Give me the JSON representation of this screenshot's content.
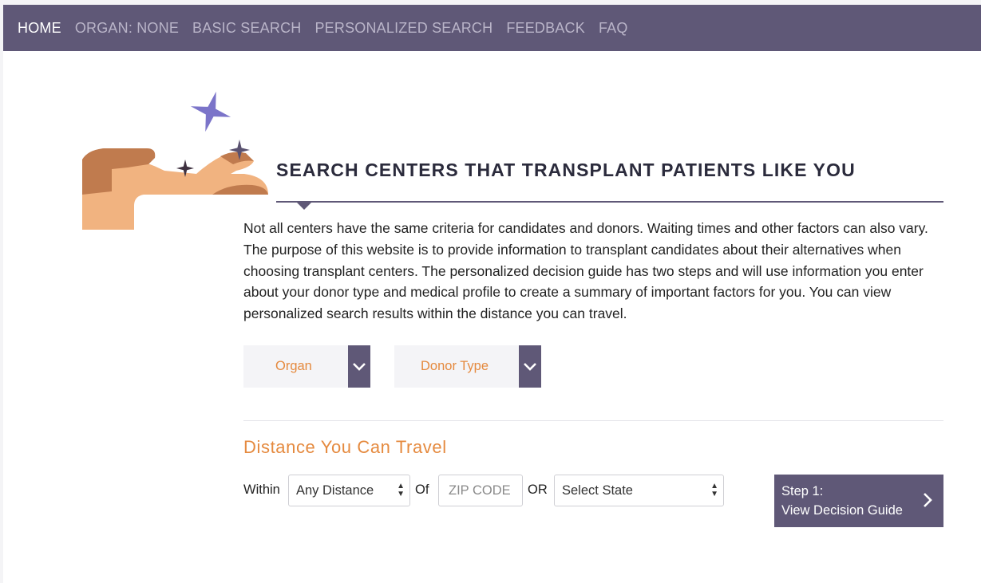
{
  "nav": {
    "items": [
      {
        "label": "HOME",
        "active": true
      },
      {
        "label": "ORGAN: NONE",
        "active": false
      },
      {
        "label": "BASIC SEARCH",
        "active": false
      },
      {
        "label": "PERSONALIZED SEARCH",
        "active": false
      },
      {
        "label": "FEEDBACK",
        "active": false
      },
      {
        "label": "FAQ",
        "active": false
      }
    ]
  },
  "hero": {
    "title": "SEARCH CENTERS THAT TRANSPLANT PATIENTS LIKE YOU",
    "intro": "Not all centers have the same criteria for candidates and donors. Waiting times and other factors can also vary. The purpose of this website is to provide information to transplant candidates about their alternatives when choosing transplant centers. The personalized decision guide has two steps and will use information you enter about your donor type and medical profile to create a summary of important factors for you. You can view personalized search results within the distance you can travel."
  },
  "filters": {
    "organ_label": "Organ",
    "donor_type_label": "Donor Type"
  },
  "distance": {
    "title": "Distance You Can Travel",
    "within_label": "Within",
    "distance_value": "Any Distance",
    "of_label": "Of",
    "zip_placeholder": "ZIP CODE",
    "or_label": "OR",
    "state_value": "Select State"
  },
  "cta": {
    "line1": "Step 1:",
    "line2": "View Decision Guide"
  },
  "colors": {
    "nav_bg": "#5f5877",
    "accent_orange": "#e58a3f",
    "purple": "#5f5877",
    "star_lavender": "#7b74c9"
  }
}
